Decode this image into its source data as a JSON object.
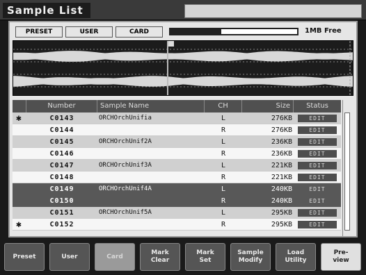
{
  "window": {
    "title": "Sample List"
  },
  "tabs": [
    {
      "label": "PRESET",
      "active": false
    },
    {
      "label": "USER",
      "active": false
    },
    {
      "label": "CARD",
      "active": true
    }
  ],
  "memory": {
    "label": "1MB Free",
    "used_fraction": 0.4
  },
  "table": {
    "headers": [
      "Number",
      "Sample Name",
      "CH",
      "Size",
      "Status"
    ],
    "rows": [
      {
        "mark": "✱",
        "number": "C0143",
        "name": "ORCHOrchUnifia",
        "ch": "L",
        "size": "276KB",
        "status": "EDIT",
        "style": "alt"
      },
      {
        "mark": "",
        "number": "C0144",
        "name": "",
        "ch": "R",
        "size": "276KB",
        "status": "EDIT",
        "style": "plain"
      },
      {
        "mark": "",
        "number": "C0145",
        "name": "ORCHOrchUnif2A",
        "ch": "L",
        "size": "236KB",
        "status": "EDIT",
        "style": "alt"
      },
      {
        "mark": "",
        "number": "C0146",
        "name": "",
        "ch": "R",
        "size": "236KB",
        "status": "EDIT",
        "style": "plain"
      },
      {
        "mark": "",
        "number": "C0147",
        "name": "ORCHOrchUnif3A",
        "ch": "L",
        "size": "221KB",
        "status": "EDIT",
        "style": "alt"
      },
      {
        "mark": "",
        "number": "C0148",
        "name": "",
        "ch": "R",
        "size": "221KB",
        "status": "EDIT",
        "style": "plain"
      },
      {
        "mark": "",
        "number": "C0149",
        "name": "ORCHOrchUnif4A",
        "ch": "L",
        "size": "240KB",
        "status": "EDIT",
        "style": "sel"
      },
      {
        "mark": "",
        "number": "C0150",
        "name": "",
        "ch": "R",
        "size": "240KB",
        "status": "EDIT",
        "style": "sel"
      },
      {
        "mark": "",
        "number": "C0151",
        "name": "ORCHOrchUnif5A",
        "ch": "L",
        "size": "295KB",
        "status": "EDIT",
        "style": "alt"
      },
      {
        "mark": "✱",
        "number": "C0152",
        "name": "",
        "ch": "R",
        "size": "295KB",
        "status": "EDIT",
        "style": "plain"
      }
    ]
  },
  "function_buttons": [
    {
      "label": "Preset",
      "state": "normal"
    },
    {
      "label": "User",
      "state": "normal"
    },
    {
      "label": "Card",
      "state": "active"
    },
    {
      "label": "Mark\nClear",
      "state": "normal"
    },
    {
      "label": "Mark\nSet",
      "state": "normal"
    },
    {
      "label": "Sample\nModify",
      "state": "normal"
    },
    {
      "label": "Load\nUtility",
      "state": "normal"
    },
    {
      "label": "Pre-\nview",
      "state": "light"
    }
  ]
}
